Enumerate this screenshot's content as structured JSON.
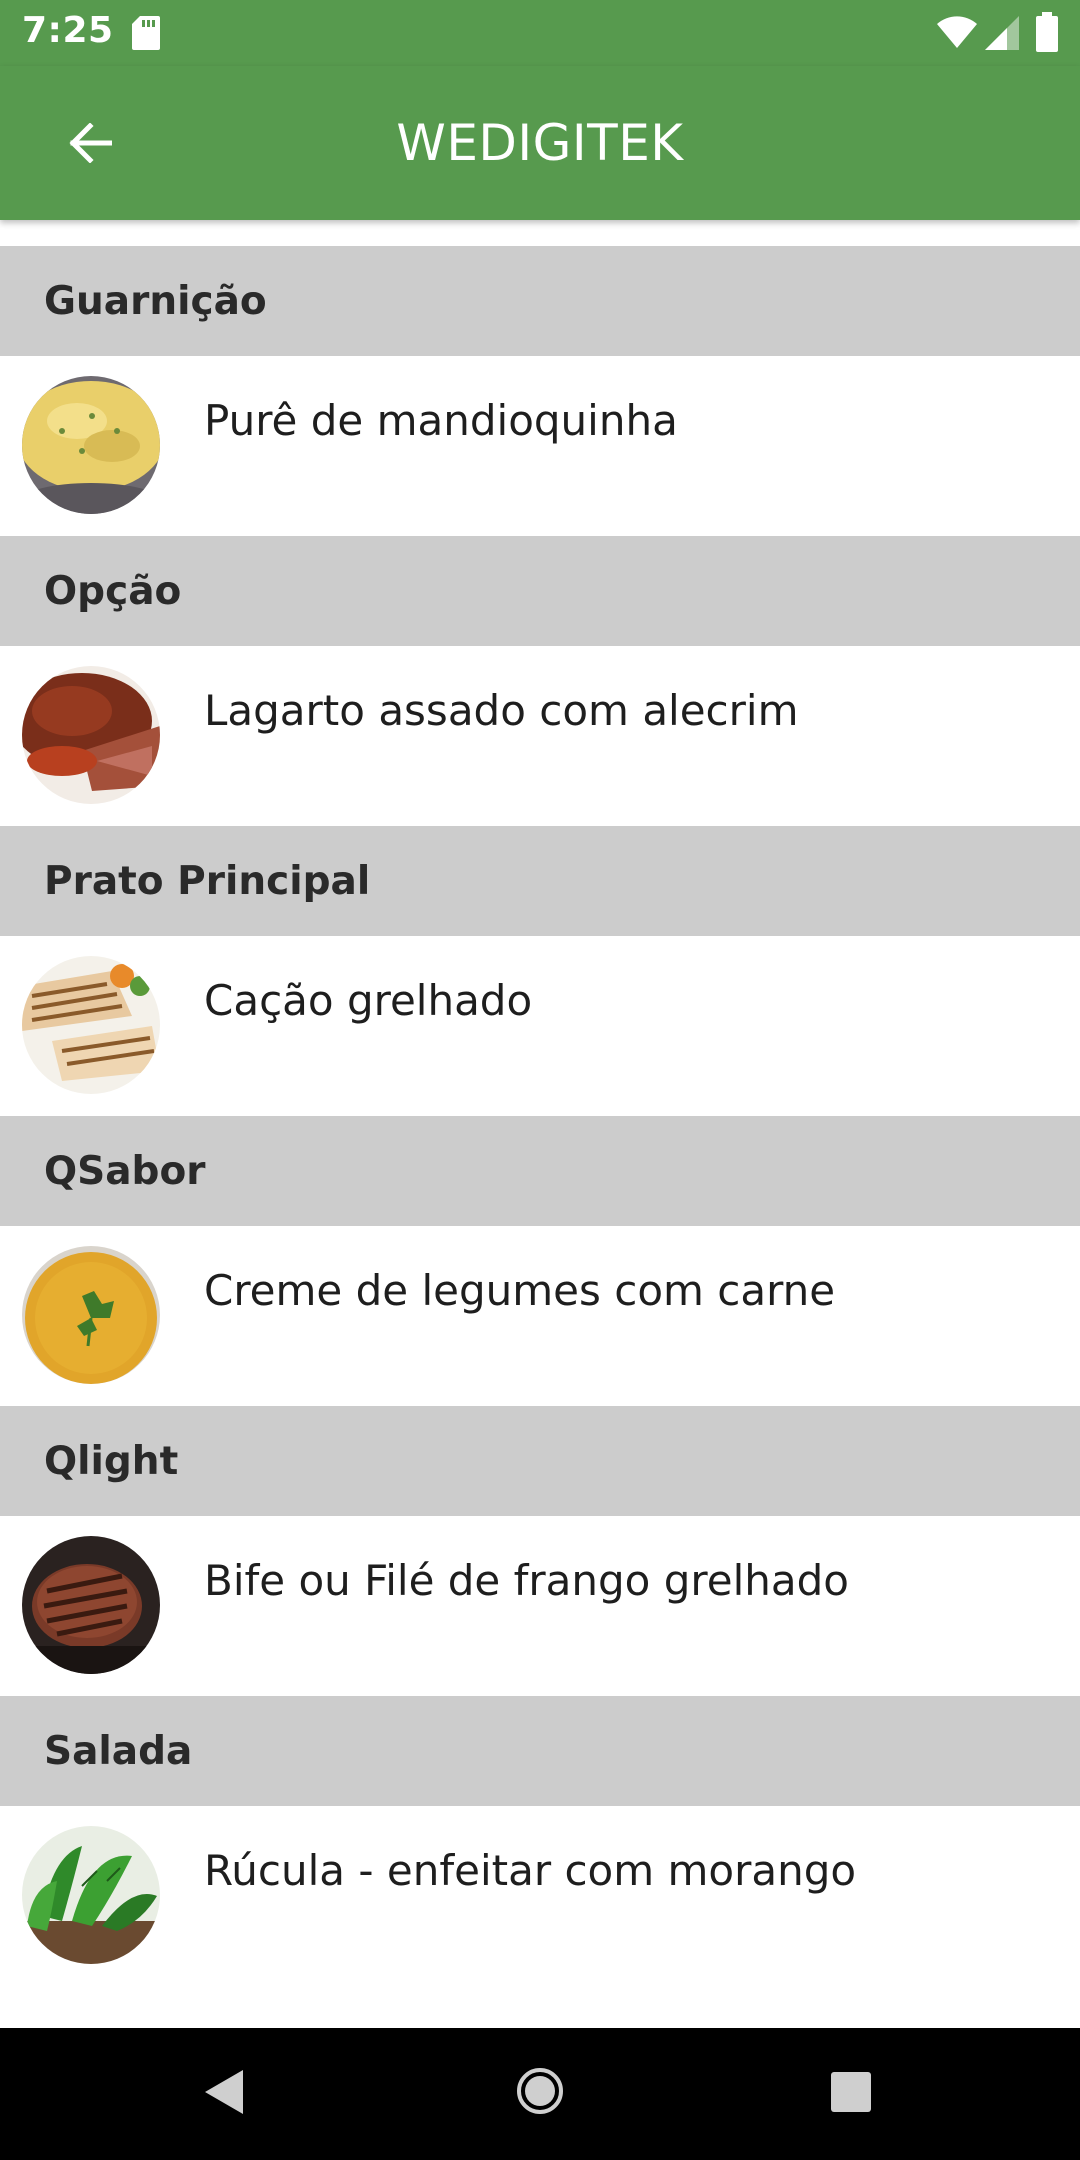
{
  "status_bar": {
    "time": "7:25",
    "icons": [
      "sd-card-icon",
      "wifi-icon",
      "signal-icon",
      "battery-icon"
    ]
  },
  "app_bar": {
    "title": "WEDIGITEK",
    "back_icon": "arrow-left-icon",
    "color": "#579a4e"
  },
  "menu": [
    {
      "category": "Guarnição",
      "dish": "Purê de mandioquinha",
      "photo": "mashed-potato-photo"
    },
    {
      "category": "Opção",
      "dish": "Lagarto assado com alecrim",
      "photo": "roast-beef-photo"
    },
    {
      "category": "Prato Principal",
      "dish": "Cação grelhado",
      "photo": "grilled-fish-photo"
    },
    {
      "category": "QSabor",
      "dish": "Creme de legumes com carne",
      "photo": "soup-photo"
    },
    {
      "category": "Qlight",
      "dish": "Bife ou Filé de frango grelhado",
      "photo": "grilled-steak-photo"
    },
    {
      "category": "Salada",
      "dish": "Rúcula - enfeitar com morango",
      "photo": "arugula-salad-photo"
    }
  ],
  "nav_bar": {
    "buttons": [
      "back-triangle-icon",
      "home-circle-icon",
      "recents-square-icon"
    ]
  }
}
